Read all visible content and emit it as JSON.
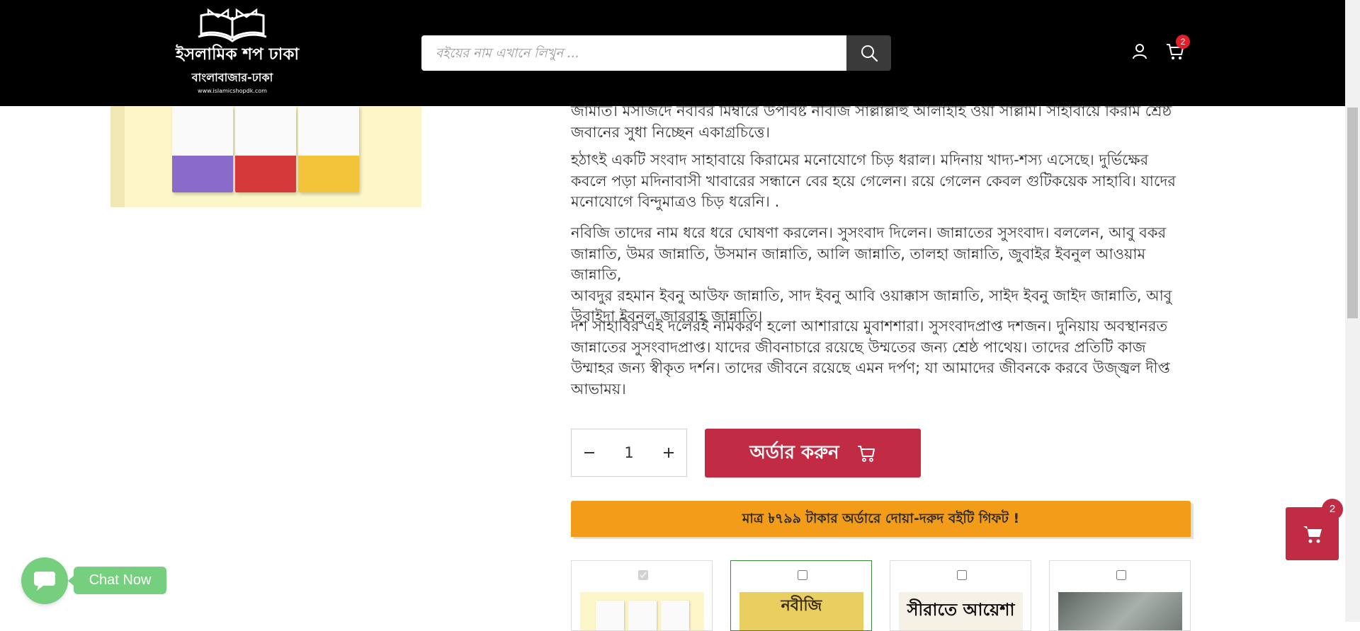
{
  "header": {
    "logo": {
      "title": "ইসলামিক শপ ঢাকা",
      "subtitle": "বাংলাবাজার-ঢাকা",
      "url": "www.islamicshopdk.com"
    },
    "search": {
      "placeholder": "বইয়ের নাম এখানে লিখুন ..."
    },
    "cart_count": "2"
  },
  "description": {
    "partial_lines": [
      "জামাত। মসজিদে নববির মিম্বারে উপবিষ্ট নবিজি সাল্লাল্লাহু আলাইহি ওয়া সাল্লাম। সাহাবায়ে কিরাম শ্রেষ্ঠ",
      "জবানের সুধা নিচ্ছেন একাগ্রচিত্তে।"
    ],
    "paragraphs": [
      [
        "হঠাৎই একটি সংবাদ সাহাবায়ে কিরামের মনোযোগে চিড় ধরাল। মদিনায় খাদ্য-শস্য এসেছে। দুর্ভিক্ষের",
        "কবলে পড়া মদিনাবাসী খাবারের সন্ধানে বের হয়ে গেলেন। রয়ে গেলেন কেবল গুটিকয়েক সাহাবি। যাদের",
        "মনোযোগে বিন্দুমাত্রও চিড় ধরেনি। ."
      ],
      [
        "নবিজি তাদের নাম ধরে ধরে ঘোষণা করলেন। সুসংবাদ দিলেন। জান্নাতের সুসংবাদ। বললেন, আবু বকর",
        "জান্নাতি, উমর জান্নাতি, উসমান জান্নাতি, আলি জান্নাতি, তালহা জান্নাতি, জুবাইর ইবনুল আওয়াম জান্নাতি,",
        "আবদুর রহমান ইবনু আউফ জান্নাতি, সাদ ইবনু আবি ওয়াক্কাস জান্নাতি, সাইদ ইবনু জাইদ জান্নাতি, আবু",
        "উবাইদা ইবনুল জাররাহ জান্নাতি।"
      ],
      [
        "দশ সাহাবির এই দলেরই নামকরণ হলো আশারায়ে মুবাশশারা। সুসংবাদপ্রাপ্ত দশজন। দুনিয়ায় অবস্থানরত",
        "জান্নাতের সুসংবাদপ্রাপ্ত। যাদের জীবনাচারে রয়েছে উম্মতের জন্য শ্রেষ্ঠ পাথেয়। তাদের প্রতিটি কাজ",
        "উম্মাহর জন্য স্বীকৃত দর্শন। তাদের জীবনে রয়েছে এমন দর্পণ; যা আমাদের জীবনকে করবে উজ্জ্বল দীপ্ত",
        "আভাময়।"
      ]
    ]
  },
  "quantity": {
    "value": "1"
  },
  "order_button": {
    "label": "অর্ডার করুন"
  },
  "gift_banner": {
    "text": "মাত্র ৳৭৯৯ টাকার অর্ডারে দোয়া-দরুদ বইটি গিফট !"
  },
  "gift_cards": [
    {
      "checked": true,
      "disabled": true,
      "thumb_text": ""
    },
    {
      "checked": false,
      "disabled": false,
      "thumb_text": "নবীজি"
    },
    {
      "checked": false,
      "disabled": false,
      "thumb_text": "সীরাতে আয়েশা"
    },
    {
      "checked": false,
      "disabled": false,
      "thumb_text": ""
    }
  ],
  "chat": {
    "label": "Chat Now"
  },
  "floating_cart": {
    "count": "2"
  },
  "colors": {
    "header_bg": "#000000",
    "order_button": "#c12b43",
    "gift_banner": "#f29c1a",
    "chat": "#76cf7e",
    "badge": "#e0202b"
  }
}
